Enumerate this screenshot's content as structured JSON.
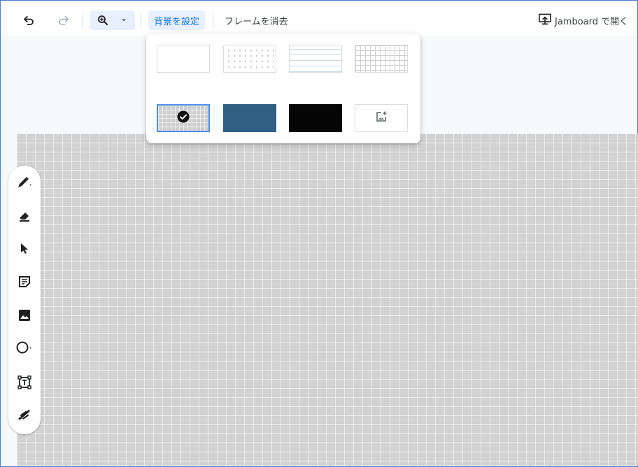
{
  "toolbar": {
    "undo_icon": "undo-icon",
    "redo_icon": "redo-icon",
    "zoom_icon": "zoom-in-icon",
    "zoom_dropdown_icon": "caret-down-icon",
    "set_background_label": "背景を設定",
    "clear_frame_label": "フレームを消去",
    "open_in_jamboard_label": "Jamboard で開く",
    "open_icon": "present-to-screen-icon"
  },
  "background_picker": {
    "options": [
      {
        "name": "plain-white",
        "selected": false
      },
      {
        "name": "dots",
        "selected": false
      },
      {
        "name": "lined",
        "selected": false
      },
      {
        "name": "grid",
        "selected": false
      },
      {
        "name": "gray-grid",
        "selected": true
      },
      {
        "name": "blue",
        "color": "#2f5f85",
        "selected": false
      },
      {
        "name": "black",
        "color": "#050505",
        "selected": false
      },
      {
        "name": "upload-image",
        "icon": "add-photo-icon",
        "selected": false
      }
    ],
    "selected_check_icon": "check-circle-icon"
  },
  "tools": [
    {
      "name": "pen-tool",
      "icon": "pen-icon"
    },
    {
      "name": "eraser-tool",
      "icon": "eraser-icon"
    },
    {
      "name": "select-tool",
      "icon": "pointer-icon"
    },
    {
      "name": "sticky-note-tool",
      "icon": "sticky-note-icon"
    },
    {
      "name": "image-tool",
      "icon": "image-icon"
    },
    {
      "name": "shape-tool",
      "icon": "circle-icon"
    },
    {
      "name": "text-box-tool",
      "icon": "text-box-icon"
    },
    {
      "name": "laser-tool",
      "icon": "laser-icon"
    }
  ],
  "colors": {
    "accent": "#1a73e8",
    "accent_bg": "#e8f0fe",
    "canvas_bg": "#d2d2d2",
    "frame_border": "#4a7fd0"
  }
}
